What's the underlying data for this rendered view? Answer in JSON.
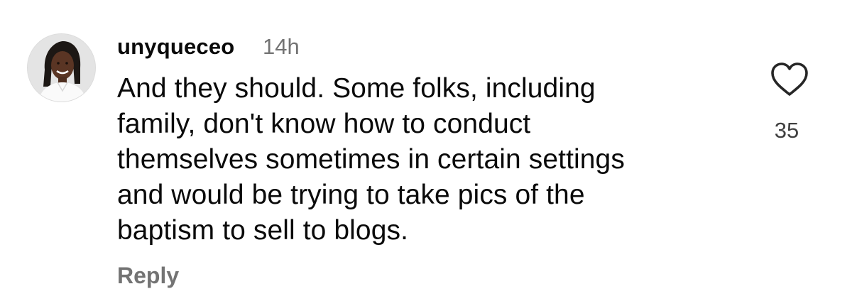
{
  "comment": {
    "username": "unyqueceo",
    "timestamp": "14h",
    "text_lines": [
      "And they should. Some folks, including",
      "family, don't know how to conduct",
      "themselves sometimes in certain settings",
      "and would be trying to take pics of the",
      "baptism to sell to blogs."
    ],
    "reply_label": "Reply",
    "like_count": "35",
    "like_icon": "heart-outline-icon",
    "colors": {
      "text": "#0a0a0a",
      "muted": "#737373"
    }
  }
}
